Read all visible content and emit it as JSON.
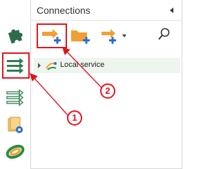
{
  "panel": {
    "title": "Connections",
    "collapse_icon": "chevron-left-icon"
  },
  "rail": {
    "items": [
      {
        "name": "puzzle-icon"
      },
      {
        "name": "connections-icon",
        "highlighted": true
      },
      {
        "name": "flows-icon"
      },
      {
        "name": "database-settings-icon"
      },
      {
        "name": "app-logo-icon"
      }
    ]
  },
  "toolbar": {
    "buttons": [
      {
        "name": "add-connection-icon",
        "highlighted": true
      },
      {
        "name": "add-folder-icon"
      },
      {
        "name": "add-dropdown-icon"
      },
      {
        "name": "search-icon"
      }
    ]
  },
  "tree": {
    "items": [
      {
        "label": "Local service",
        "icon": "local-service-icon",
        "expanded": false
      }
    ]
  },
  "annotations": {
    "callout_1": "1",
    "callout_2": "2",
    "color": "#e0141e"
  },
  "colors": {
    "accent_green": "#2e7d4f",
    "accent_orange": "#f0a035",
    "accent_blue": "#2a6fc9"
  }
}
